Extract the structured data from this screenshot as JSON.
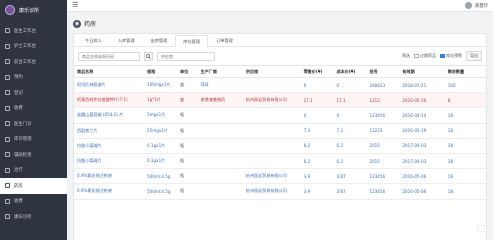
{
  "sidebar": {
    "brand": "康乐诊所",
    "items": [
      {
        "label": "医生工作台",
        "active": false
      },
      {
        "label": "护士工作台",
        "active": false
      },
      {
        "label": "前台工作台",
        "active": false
      },
      {
        "label": "预约",
        "active": false
      },
      {
        "label": "登记",
        "active": false
      },
      {
        "label": "收费",
        "active": false
      },
      {
        "label": "医生门诊",
        "active": false
      },
      {
        "label": "库存管理",
        "active": false
      },
      {
        "label": "辅助检查",
        "active": false
      },
      {
        "label": "治疗",
        "active": false
      },
      {
        "label": "药房",
        "active": true
      },
      {
        "label": "收费",
        "active": false
      },
      {
        "label": "康乐诊所",
        "active": false
      }
    ]
  },
  "topbar": {
    "user": "黄慧玲"
  },
  "page": {
    "title": "药房"
  },
  "tabs": [
    "今日病人",
    "入库管理",
    "出库管理",
    "库存管理",
    "订单管理"
  ],
  "active_tab": 3,
  "filters": {
    "name_placeholder": "商品名称或条形码",
    "supplier_placeholder": "供应商",
    "label": "筛选",
    "check1": "过期药品",
    "check2": "库存预警",
    "button": "导出"
  },
  "table": {
    "headers": [
      "商品名称",
      "规格",
      "单位",
      "生产厂商",
      "供应商",
      "零售价(¥)",
      "成本价(¥)",
      "批号",
      "有效期",
      "剩余数量"
    ],
    "rows": [
      [
        "阿司匹林肠溶片",
        "100mgx1片",
        "盒",
        "拜耳",
        "",
        "0",
        "0",
        "160623",
        "2018-07-21",
        "100"
      ],
      [
        "阿莫西林克拉维酸钾片(7:1)",
        "1g*1片",
        "盒",
        "香港澳美制药",
        "杭州医岩贸易有限公司",
        "17.1",
        "17.1",
        "1212",
        "2016-05-30",
        "8"
      ],
      [
        "盐酸山莨菪碱 (654-2) 片",
        "5mgx1片",
        "瓶",
        "",
        "",
        "0",
        "0",
        "123456",
        "2016-04-14",
        "18"
      ],
      [
        "西酞普兰片",
        "25mgx1片",
        "瓶",
        "",
        "",
        "7.3",
        "7.3",
        "12223",
        "2016-05-19",
        "18"
      ],
      [
        "拉酰小菜碱片",
        "0.1gx1片",
        "瓶",
        "",
        "",
        "6.2",
        "6.2",
        "2015",
        "2017-04-03",
        "18"
      ],
      [
        "拉酰小菜碱片",
        "0.1gx1片",
        "瓶",
        "",
        "",
        "6.2",
        "6.2",
        "2015",
        "2017-04-03",
        "18"
      ],
      [
        "0.9%氯化钠注射液",
        "500ml:4.5g",
        "瓶",
        "",
        "杭州医岩贸易有限公司",
        "3.9",
        "3.87",
        "123456",
        "2016-05-06",
        "18"
      ],
      [
        "0.9%氯化钠注射液",
        "500ml:4.5g",
        "瓶",
        "",
        "杭州医岩贸易有限公司",
        "3.9",
        "3.87",
        "123456",
        "2016-05-06",
        "18"
      ]
    ]
  }
}
